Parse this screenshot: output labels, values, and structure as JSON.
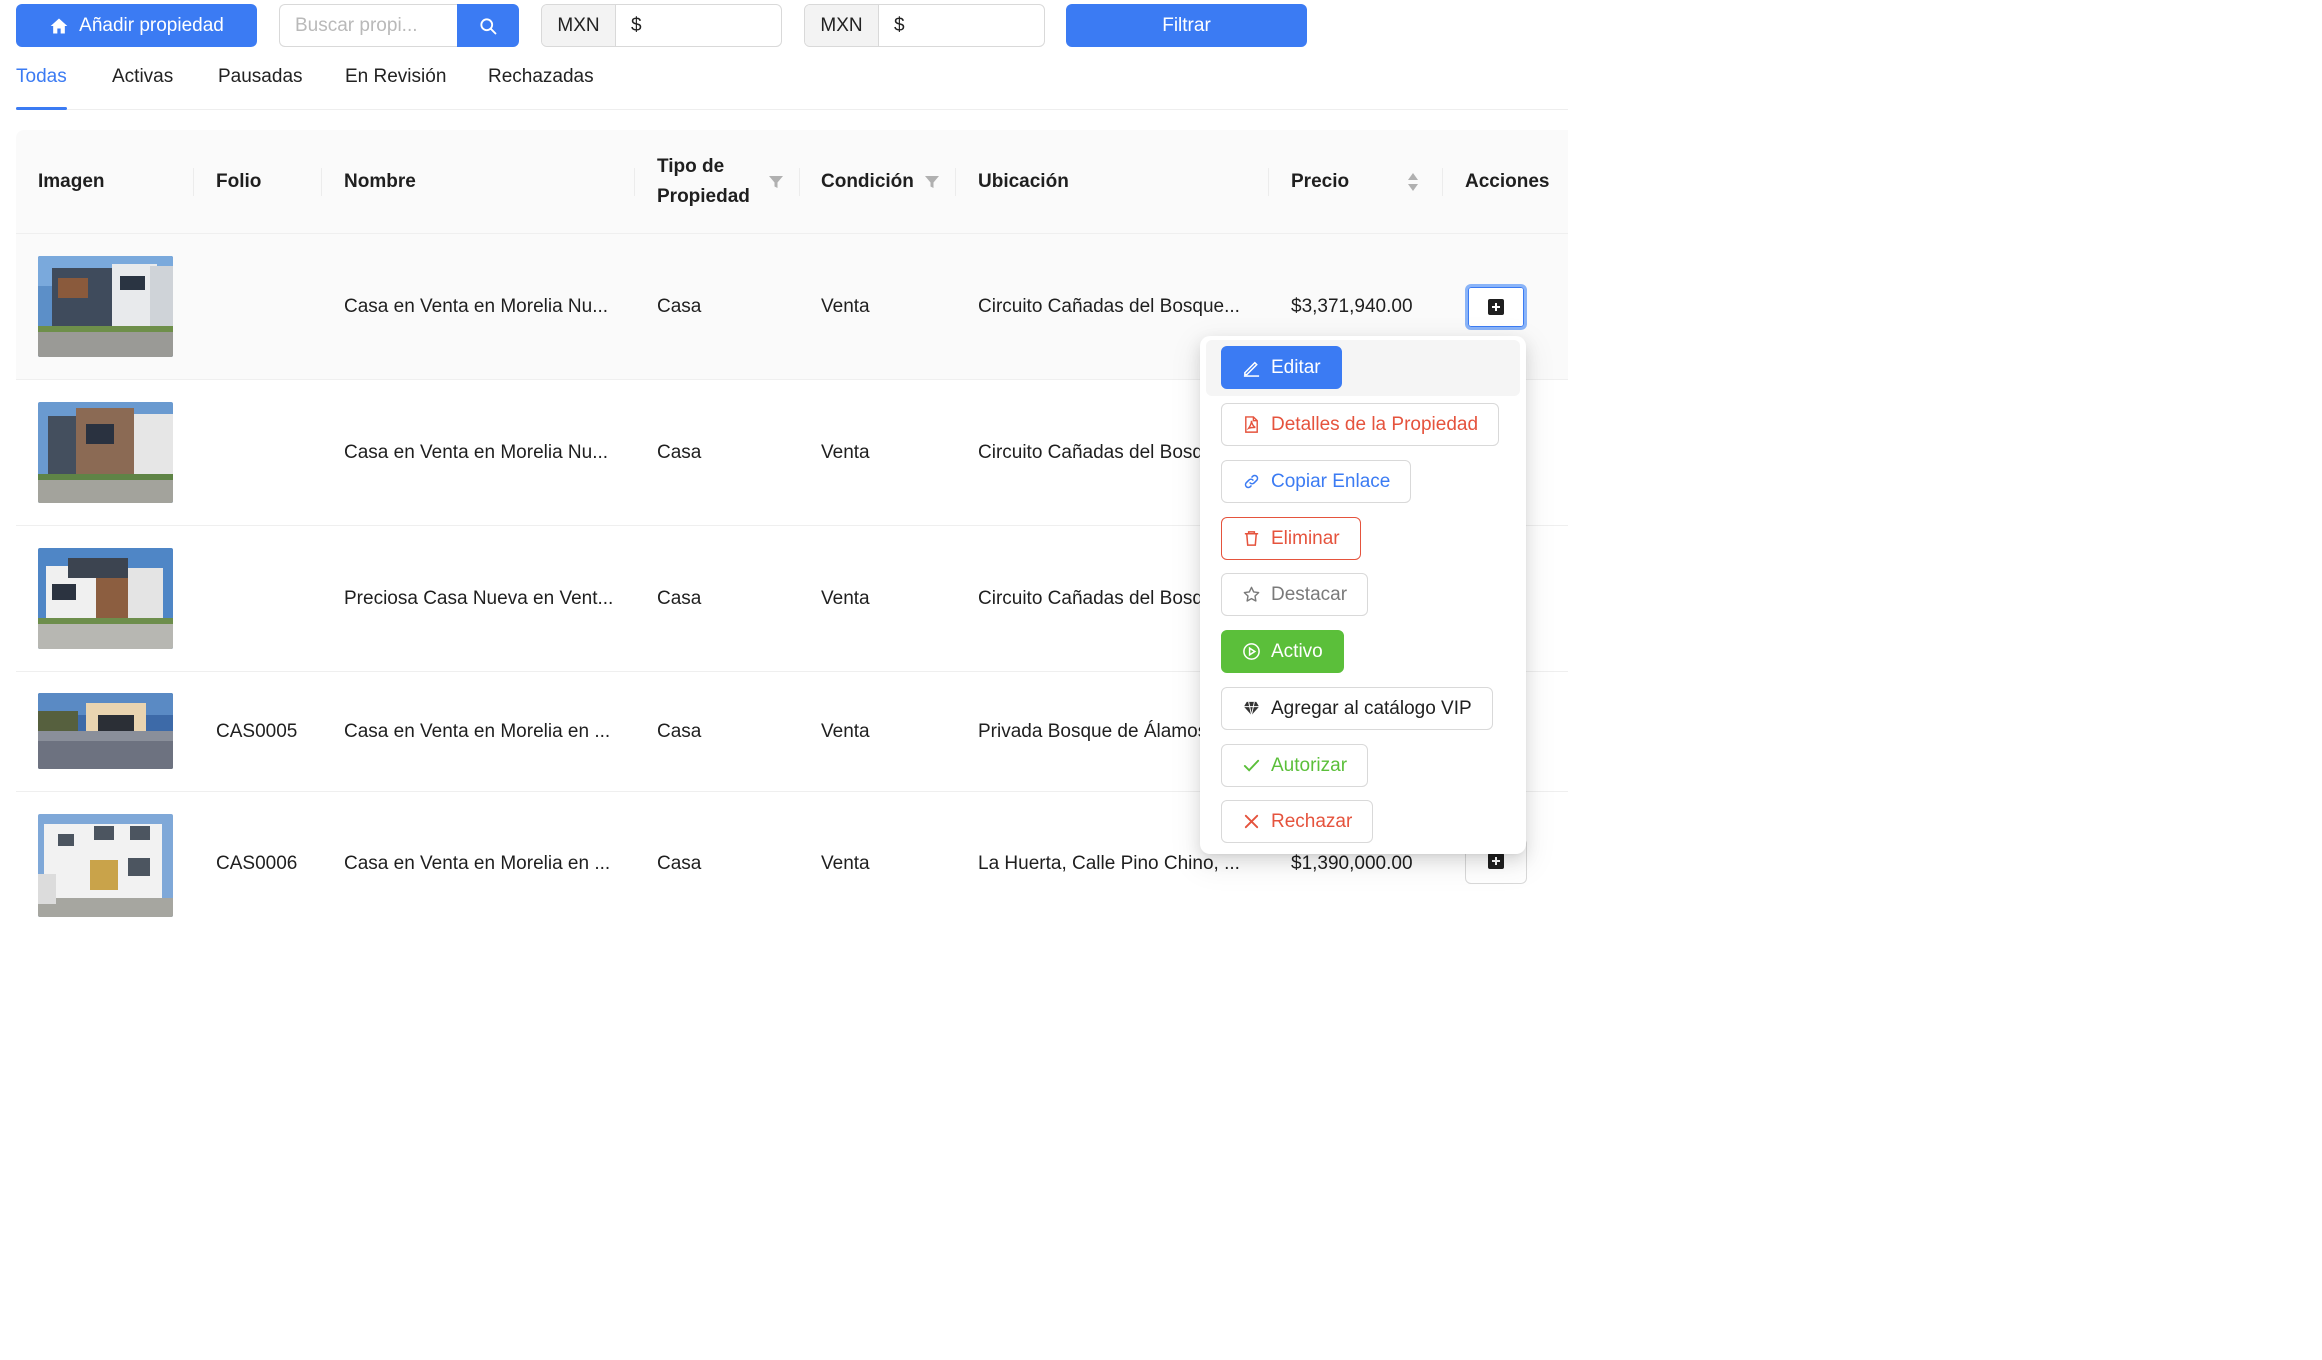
{
  "toolbar": {
    "add_label": "Añadir propiedad",
    "search_placeholder": "Buscar propi...",
    "min_currency": "MXN",
    "min_symbol": "$",
    "max_currency": "MXN",
    "max_symbol": "$",
    "filter_label": "Filtrar"
  },
  "tabs": [
    "Todas",
    "Activas",
    "Pausadas",
    "En Revisión",
    "Rechazadas"
  ],
  "table": {
    "columns": {
      "image": "Imagen",
      "folio": "Folio",
      "name": "Nombre",
      "type": "Tipo de Propiedad",
      "condition": "Condición",
      "location": "Ubicación",
      "price": "Precio",
      "actions": "Acciones"
    },
    "rows": [
      {
        "folio": "",
        "name": "Casa en Venta en Morelia Nu...",
        "type": "Casa",
        "condition": "Venta",
        "location": "Circuito Cañadas del Bosque...",
        "price": "$3,371,940.00"
      },
      {
        "folio": "",
        "name": "Casa en Venta en Morelia Nu...",
        "type": "Casa",
        "condition": "Venta",
        "location": "Circuito Cañadas del Bosque...",
        "price": ""
      },
      {
        "folio": "",
        "name": "Preciosa Casa Nueva en Vent...",
        "type": "Casa",
        "condition": "Venta",
        "location": "Circuito Cañadas del Bosque...",
        "price": ""
      },
      {
        "folio": "CAS0005",
        "name": "Casa en Venta en Morelia en ...",
        "type": "Casa",
        "condition": "Venta",
        "location": "Privada Bosque de Álamos...",
        "price": ""
      },
      {
        "folio": "CAS0006",
        "name": "Casa en Venta en Morelia en ...",
        "type": "Casa",
        "condition": "Venta",
        "location": "La Huerta, Calle Pino Chino, ...",
        "price": "$1,390,000.00"
      }
    ]
  },
  "dropdown": {
    "edit": "Editar",
    "details": "Detalles de la Propiedad",
    "copy_link": "Copiar Enlace",
    "delete": "Eliminar",
    "feature": "Destacar",
    "active": "Activo",
    "vip": "Agregar al catálogo VIP",
    "authorize": "Autorizar",
    "reject": "Rechazar"
  },
  "colors": {
    "primary": "#3b7bf3",
    "danger": "#e5533d",
    "success": "#5bbf3a"
  }
}
